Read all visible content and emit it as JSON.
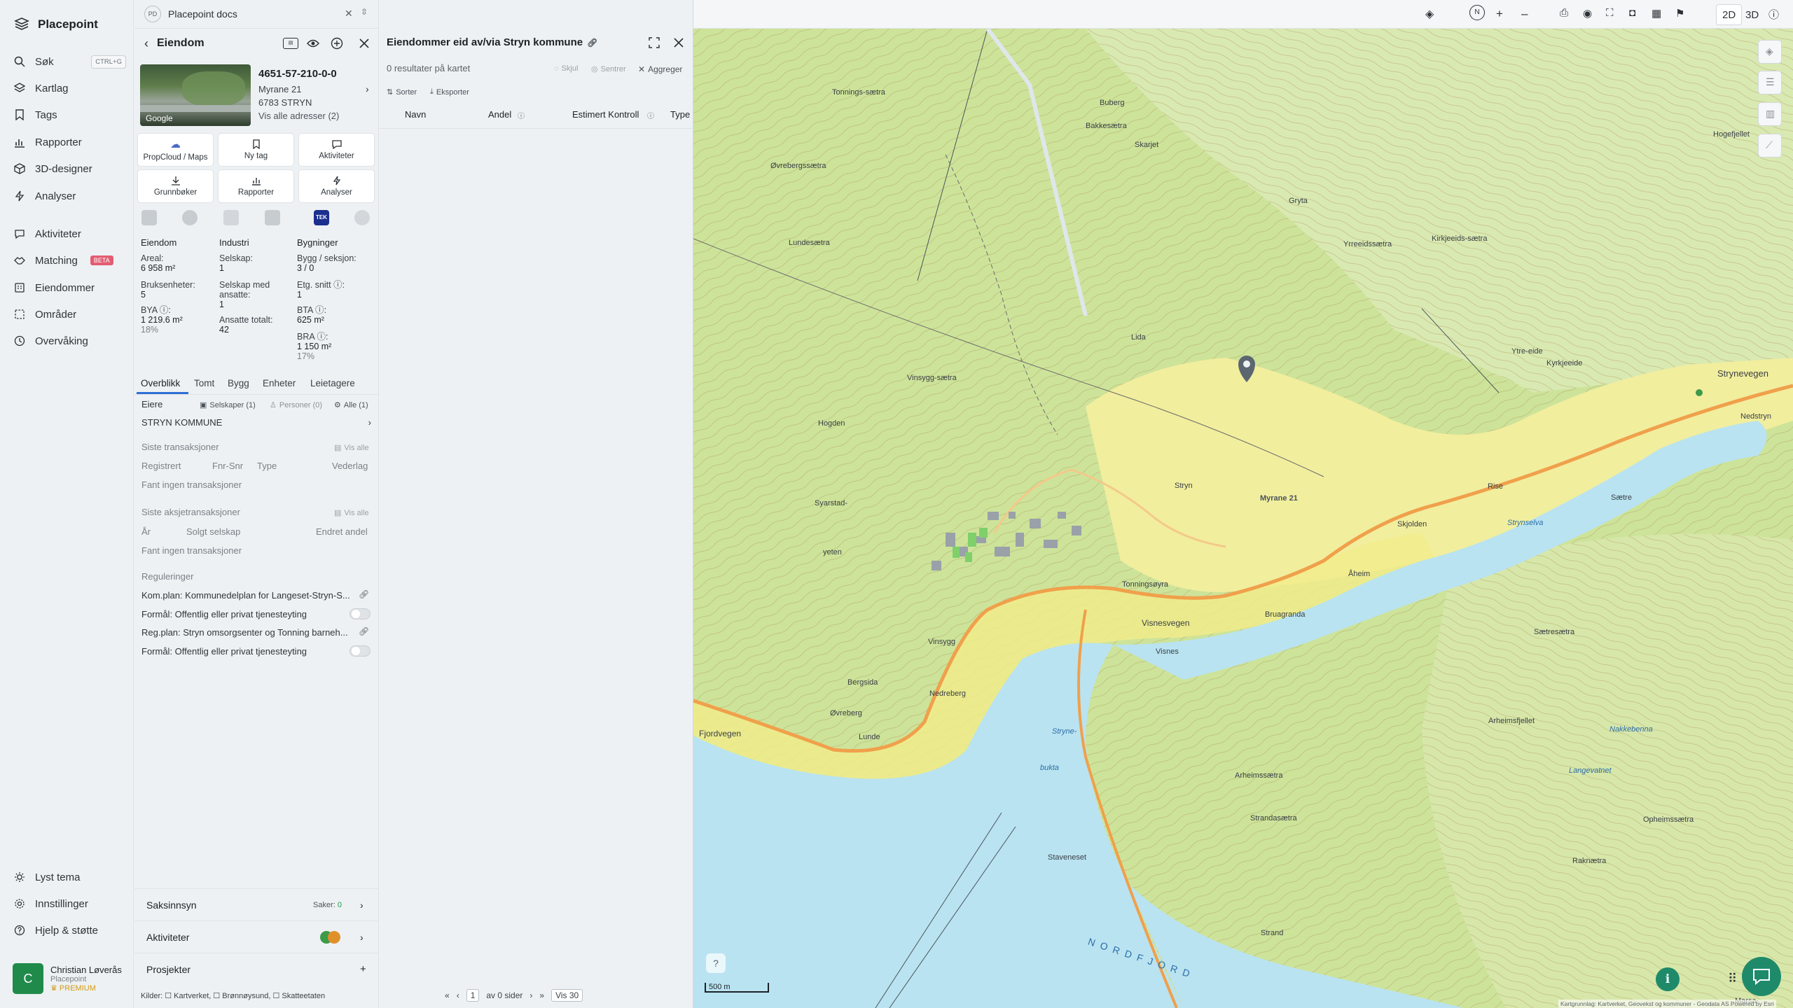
{
  "app": {
    "brand": "Placepoint"
  },
  "nav": {
    "items": [
      {
        "label": "Søk",
        "shortcut": "CTRL+G",
        "icon": "search-icon"
      },
      {
        "label": "Kartlag",
        "icon": "layers-icon"
      },
      {
        "label": "Tags",
        "icon": "bookmark-icon"
      },
      {
        "label": "Rapporter",
        "icon": "chart-icon"
      },
      {
        "label": "3D-designer",
        "icon": "cube-icon"
      },
      {
        "label": "Analyser",
        "icon": "bolt-icon"
      },
      {
        "label": "Aktiviteter",
        "icon": "chat-icon"
      },
      {
        "label": "Matching",
        "badge": "BETA",
        "icon": "handshake-icon"
      },
      {
        "label": "Eiendommer",
        "icon": "building-icon"
      },
      {
        "label": "Områder",
        "icon": "area-icon"
      },
      {
        "label": "Overvåking",
        "icon": "clock-icon"
      }
    ],
    "bottom": [
      {
        "label": "Lyst tema",
        "icon": "sun-icon"
      },
      {
        "label": "Innstillinger",
        "icon": "gear-icon"
      },
      {
        "label": "Hjelp & støtte",
        "icon": "help-icon"
      }
    ],
    "user": {
      "initial": "C",
      "name": "Christian Løverås",
      "org": "Placepoint",
      "plan": "PREMIUM"
    }
  },
  "search": {
    "badge": "PD",
    "value": "Placepoint docs"
  },
  "property": {
    "header": "Eiendom",
    "photo_label": "Google",
    "id": "4651-57-210-0-0",
    "street": "Myrane 21",
    "postal": "6783 STRYN",
    "all_addresses": "Vis alle adresser (2)",
    "tiles": [
      "PropCloud / Maps",
      "Ny tag",
      "Aktiviteter",
      "Grunnbøker",
      "Rapporter",
      "Analyser"
    ],
    "stats": {
      "eiendom": {
        "heading": "Eiendom",
        "areal_label": "Areal:",
        "areal_value": "6 958 m²",
        "bruks_label": "Bruksenheter:",
        "bruks_value": "5",
        "bya_label": "BYA ⓘ:",
        "bya_value": "1 219.6 m²",
        "bya_pct": "18%"
      },
      "industri": {
        "heading": "Industri",
        "selskap_label": "Selskap:",
        "selskap_value": "1",
        "ansatte_label": "Selskap med ansatte:",
        "ansatte_value": "1",
        "totalt_label": "Ansatte totalt:",
        "totalt_value": "42"
      },
      "bygninger": {
        "heading": "Bygninger",
        "bygg_label": "Bygg / seksjon:",
        "bygg_value": "3 / 0",
        "etg_label": "Etg. snitt ⓘ:",
        "etg_value": "1",
        "bta_label": "BTA ⓘ:",
        "bta_value": "625 m²",
        "bra_label": "BRA ⓘ:",
        "bra_value": "1 150 m²",
        "bra_pct": "17%"
      }
    },
    "tabs": [
      "Overblikk",
      "Tomt",
      "Bygg",
      "Enheter",
      "Leietagere"
    ],
    "owners": {
      "heading": "Eiere",
      "filters": [
        "Selskaper (1)",
        "Personer (0)",
        "Alle (1)"
      ],
      "owner": "STRYN KOMMUNE"
    },
    "transactions": {
      "heading": "Siste transaksjoner",
      "show_all": "Vis alle",
      "cols": [
        "Registrert",
        "Fnr-Snr",
        "Type",
        "Vederlag"
      ],
      "empty": "Fant ingen transaksjoner"
    },
    "share_transactions": {
      "heading": "Siste aksjetransaksjoner",
      "show_all": "Vis alle",
      "cols": [
        "År",
        "Solgt selskap",
        "Endret andel"
      ],
      "empty": "Fant ingen transaksjoner"
    },
    "regulations": {
      "heading": "Reguleringer",
      "items": [
        "Kom.plan: Kommunedelplan for Langeset-Stryn-S...",
        "Formål: Offentlig eller privat tjenesteyting",
        "Reg.plan: Stryn omsorgsenter og Tonning barneh...",
        "Formål: Offentlig eller privat tjenesteyting"
      ]
    },
    "accordions": {
      "saksinnsyn": "Saksinnsyn",
      "saker_label": "Saker:",
      "saker_value": "0",
      "aktiviteter": "Aktiviteter",
      "prosjekter": "Prosjekter"
    },
    "clients": "Kilder: ☐ Kartverket, ☐ Brønnøysund, ☐ Skatteetaten"
  },
  "results": {
    "title": "Eiendommer eid av/via Stryn kommune",
    "count": "0 resultater på kartet",
    "actions": [
      "Skjul",
      "Sentrer",
      "Aggreger"
    ],
    "toolbar": [
      "Sorter",
      "Eksporter"
    ],
    "columns": [
      "Navn",
      "Andel",
      "Estimert Kontroll",
      "Type"
    ],
    "pager": {
      "page": "1",
      "of": "av 0 sider",
      "per_page": "Vis 30"
    }
  },
  "map": {
    "view_modes": [
      "2D",
      "3D"
    ],
    "active_mode": "2D",
    "scale": "500 m",
    "attribution": "Kartgrunnlag: Kartverket, Geovekst og kommuner - Geodata AS Powered by Esri",
    "marker_label": "Myrane 21",
    "colors": {
      "forest": "#c7df8f",
      "open": "#f1ee9e",
      "water": "#b9e3f1",
      "road": "#f0a04b",
      "accent": "#1f8a6a"
    },
    "places": [
      "Tonnings-sætra",
      "Buberg",
      "Skarjet",
      "Bakkesætra",
      "Øvrebergssætra",
      "Gryta",
      "Lundesætra",
      "Yrreeidssætra",
      "Kirkjeeids-sætra",
      "Lida",
      "Vinsygg-sætra",
      "Ytre-eide",
      "Kyrkjeeide",
      "Strynevegen",
      "Hogden",
      "Stryn",
      "Nedstryn",
      "Rise",
      "Sætre",
      "Skjolden",
      "Strynselva",
      "Åheim",
      "Syarstad-",
      "yeten",
      "Tonningsøyra",
      "Visnesvegen",
      "Bruagranda",
      "Visnes",
      "Sætresætra",
      "Vinsygg",
      "Bergsida",
      "Nedreberg",
      "Øvreberg",
      "Lunde",
      "Fjordvegen",
      "Stryne-",
      "bukta",
      "Arheimsfjellet",
      "Arheimssætra",
      "Strandasætra",
      "Staveneset",
      "Raknætra",
      "Strand",
      "NORDFJORD",
      "Hogefjellet",
      "Nakkebenna",
      "Langevatnet",
      "Opheimssætra",
      "Marsa-"
    ]
  }
}
